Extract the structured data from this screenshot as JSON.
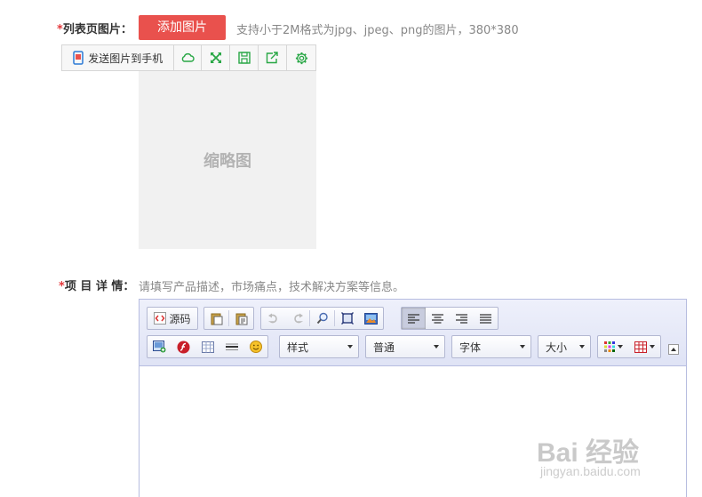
{
  "list_image": {
    "required_mark": "*",
    "label": "列表页图片：",
    "add_button": "添加图片",
    "hint": "支持小于2M格式为jpg、jpeg、png的图片，380*380",
    "send_to_phone": "发送图片到手机",
    "thumbnail": "缩略图",
    "toolbar_icons": [
      "cloud-icon",
      "expand-icon",
      "save-icon",
      "share-icon",
      "gear-icon"
    ]
  },
  "details": {
    "required_mark": "*",
    "label": "项 目 详 情：",
    "hint": "请填写产品描述，市场痛点，技术解决方案等信息。"
  },
  "editor": {
    "source_label": "源码",
    "style_label": "样式",
    "format_label": "普通",
    "font_label": "字体",
    "size_label": "大小",
    "content": ""
  },
  "watermark": {
    "text": "Bai 经验",
    "sub": "jingyan.baidu.com"
  },
  "colors": {
    "accent_red": "#e9514d",
    "icon_green": "#28a745",
    "editor_border": "#b7bde0"
  }
}
